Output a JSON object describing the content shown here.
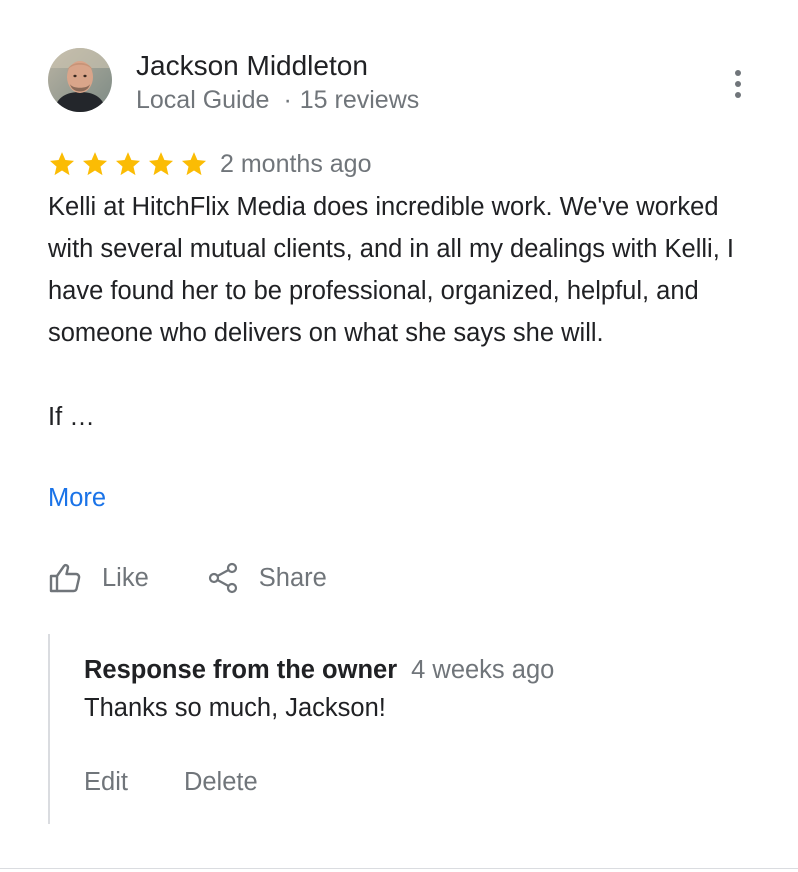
{
  "review": {
    "author": {
      "name": "Jackson Middleton",
      "badge": "Local Guide",
      "separator": "·",
      "review_count": "15 reviews",
      "avatar_icon": "profile-photo"
    },
    "menu_icon": "more-vert-icon",
    "rating": 5,
    "rating_max": 5,
    "star_color": "#fbbc04",
    "date": "2 months ago",
    "text": "Kelli at HitchFlix Media does incredible work. We've worked with several mutual clients, and in all my dealings with Kelli, I have found her to be professional, organized, helpful, and someone who delivers on what she says she will.\n\nIf …",
    "more_label": "More",
    "link_color": "#1a73e8",
    "actions": {
      "like_icon": "thumb-up-icon",
      "like_label": "Like",
      "share_icon": "share-icon",
      "share_label": "Share"
    },
    "owner_response": {
      "title": "Response from the owner",
      "date": "4 weeks ago",
      "text": "Thanks so much, Jackson!",
      "edit_label": "Edit",
      "delete_label": "Delete"
    }
  }
}
